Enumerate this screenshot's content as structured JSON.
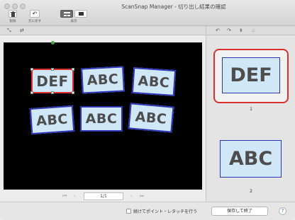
{
  "window": {
    "title": "ScanSnap Manager - 切り出し結果の確認"
  },
  "toolbar": {
    "delete_label": "削除",
    "undo_label": "元に戻す",
    "view_label": "表示"
  },
  "canvas": {
    "cards": [
      {
        "text": "DEF",
        "selected": true
      },
      {
        "text": "ABC",
        "selected": false
      },
      {
        "text": "ABC",
        "selected": false
      },
      {
        "text": "ABC",
        "selected": false
      },
      {
        "text": "ABC",
        "selected": false
      },
      {
        "text": "ABC",
        "selected": false
      }
    ]
  },
  "pager": {
    "page": "1/1"
  },
  "thumbnails": [
    {
      "text": "DEF",
      "number": "1",
      "selected": true
    },
    {
      "text": "ABC",
      "number": "2",
      "selected": false
    }
  ],
  "footer": {
    "continue_label": "続けてポイント・レタッチを行う",
    "save_label": "保存して終了",
    "help_label": "?"
  },
  "icons": {
    "delete": "trash-icon",
    "undo": "undo-icon",
    "view_thumbs": "thumbnail-view-icon",
    "view_single": "single-view-icon",
    "rotate_left": "rotate-left-icon",
    "rotate_right": "rotate-right-icon",
    "flip": "flip-icon",
    "crop": "crop-icon"
  },
  "colors": {
    "card_border": "#2d35b8",
    "card_fill": "#cfe7f7",
    "selection": "#d9302c",
    "rotate_handle": "#3aa648"
  }
}
